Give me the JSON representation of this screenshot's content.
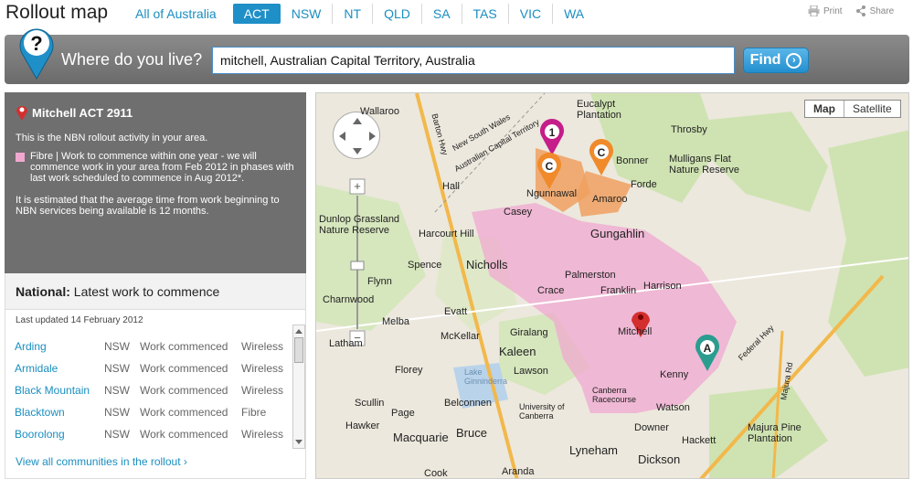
{
  "header": {
    "title": "Rollout map",
    "tabs": [
      {
        "label": "All of Australia",
        "active": false
      },
      {
        "label": "ACT",
        "active": true
      },
      {
        "label": "NSW",
        "active": false
      },
      {
        "label": "NT",
        "active": false
      },
      {
        "label": "QLD",
        "active": false
      },
      {
        "label": "SA",
        "active": false
      },
      {
        "label": "TAS",
        "active": false
      },
      {
        "label": "VIC",
        "active": false
      },
      {
        "label": "WA",
        "active": false
      }
    ],
    "print_label": "Print",
    "share_label": "Share"
  },
  "search": {
    "prompt": "Where do you live?",
    "value": "mitchell, Australian Capital Territory, Australia",
    "button": "Find"
  },
  "info": {
    "location": "Mitchell ACT 2911",
    "intro": "This is the NBN rollout activity in your area.",
    "fibre_text": "Fibre | Work to commence within one year - we will commence work in your area from Feb 2012 in phases with last work scheduled to commence in Aug 2012*.",
    "average": "It is estimated that the average time from work beginning to NBN services being available is 12 months.",
    "fibre_color": "#f0a8d0"
  },
  "national": {
    "label_bold": "National:",
    "label_rest": " Latest work to commence",
    "updated": "Last updated 14 February 2012",
    "rows": [
      {
        "community": "Arding",
        "state": "NSW",
        "status": "Work commenced",
        "tech": "Wireless"
      },
      {
        "community": "Armidale",
        "state": "NSW",
        "status": "Work commenced",
        "tech": "Wireless"
      },
      {
        "community": "Black Mountain",
        "state": "NSW",
        "status": "Work commenced",
        "tech": "Wireless"
      },
      {
        "community": "Blacktown",
        "state": "NSW",
        "status": "Work commenced",
        "tech": "Fibre"
      },
      {
        "community": "Boorolong",
        "state": "NSW",
        "status": "Work commenced",
        "tech": "Wireless"
      }
    ],
    "view_all": "View all communities in the rollout ›"
  },
  "map": {
    "type_map": "Map",
    "type_satellite": "Satellite",
    "markers": {
      "one": "1",
      "c": "C",
      "a": "A"
    },
    "labels": [
      {
        "text": "Wallaroo",
        "kind": "n"
      },
      {
        "text": "New South Wales",
        "kind": "sm"
      },
      {
        "text": "Australian Capital Territory",
        "kind": "sm"
      },
      {
        "text": "Eucalypt Plantation",
        "kind": "n"
      },
      {
        "text": "Throsby",
        "kind": "n"
      },
      {
        "text": "Mulligans Flat Nature Reserve",
        "kind": "n"
      },
      {
        "text": "Bonner",
        "kind": "n"
      },
      {
        "text": "Forde",
        "kind": "n"
      },
      {
        "text": "Amaroo",
        "kind": "n"
      },
      {
        "text": "Ngunnawal",
        "kind": "n"
      },
      {
        "text": "Hall",
        "kind": "n"
      },
      {
        "text": "Casey",
        "kind": "n"
      },
      {
        "text": "Gungahlin",
        "kind": "big"
      },
      {
        "text": "Dunlop Grassland Nature Reserve",
        "kind": "n"
      },
      {
        "text": "Harcourt Hill",
        "kind": "n"
      },
      {
        "text": "Spence",
        "kind": "n"
      },
      {
        "text": "Nicholls",
        "kind": "big"
      },
      {
        "text": "Palmerston",
        "kind": "n"
      },
      {
        "text": "Harrison",
        "kind": "n"
      },
      {
        "text": "Flynn",
        "kind": "n"
      },
      {
        "text": "Charnwood",
        "kind": "n"
      },
      {
        "text": "Crace",
        "kind": "n"
      },
      {
        "text": "Franklin",
        "kind": "n"
      },
      {
        "text": "Evatt",
        "kind": "n"
      },
      {
        "text": "Melba",
        "kind": "n"
      },
      {
        "text": "Giralang",
        "kind": "n"
      },
      {
        "text": "McKellar",
        "kind": "n"
      },
      {
        "text": "Mitchell",
        "kind": "n"
      },
      {
        "text": "Kaleen",
        "kind": "big"
      },
      {
        "text": "Florey",
        "kind": "n"
      },
      {
        "text": "Lawson",
        "kind": "n"
      },
      {
        "text": "Lake Ginninderra",
        "kind": "sm"
      },
      {
        "text": "Kenny",
        "kind": "n"
      },
      {
        "text": "Canberra Racecourse",
        "kind": "sm"
      },
      {
        "text": "Scullin",
        "kind": "n"
      },
      {
        "text": "Belconnen",
        "kind": "n"
      },
      {
        "text": "University of Canberra",
        "kind": "sm"
      },
      {
        "text": "Watson",
        "kind": "n"
      },
      {
        "text": "Page",
        "kind": "n"
      },
      {
        "text": "Hawker",
        "kind": "n"
      },
      {
        "text": "Bruce",
        "kind": "big"
      },
      {
        "text": "Downer",
        "kind": "n"
      },
      {
        "text": "Hackett",
        "kind": "n"
      },
      {
        "text": "Majura Pine Plantation",
        "kind": "n"
      },
      {
        "text": "Macquarie",
        "kind": "big"
      },
      {
        "text": "Lyneham",
        "kind": "big"
      },
      {
        "text": "Dickson",
        "kind": "big"
      },
      {
        "text": "Cook",
        "kind": "n"
      },
      {
        "text": "Aranda",
        "kind": "n"
      },
      {
        "text": "Barton Hwy",
        "kind": "sm"
      },
      {
        "text": "Federal Hwy",
        "kind": "sm"
      },
      {
        "text": "Majura Rd",
        "kind": "sm"
      },
      {
        "text": "Latham",
        "kind": "n"
      }
    ]
  }
}
